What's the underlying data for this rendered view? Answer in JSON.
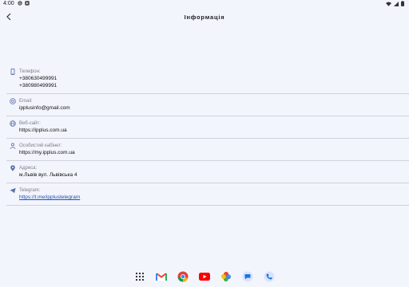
{
  "status_bar": {
    "time": "4:00",
    "icons": [
      "google-icon",
      "play-icon",
      "wifi-icon",
      "signal-icon",
      "battery-icon"
    ]
  },
  "app_bar": {
    "title": "Інформація",
    "back_icon": "arrow-back-icon"
  },
  "contacts": {
    "phone": {
      "label": "Телефон:",
      "values": [
        "+380630499991",
        "+380980499991"
      ],
      "icon": "phone-icon"
    },
    "email": {
      "label": "Email:",
      "value": "ipplusinfo@gmail.com",
      "icon": "at-icon"
    },
    "website": {
      "label": "Веб-сайт:",
      "value": "https://ipplus.com.ua",
      "icon": "globe-icon"
    },
    "cabinet": {
      "label": "Особистий кабінет:",
      "value": "https://my.ipplus.com.ua",
      "icon": "person-icon"
    },
    "address": {
      "label": "Адреса:",
      "value": "м.Львів вул. Львівська 4",
      "icon": "location-icon"
    },
    "telegram": {
      "label": "Telegram:",
      "value": "https://t.me/ipplustelegram",
      "icon": "telegram-icon"
    }
  },
  "dock": {
    "apps": [
      "app-drawer-icon",
      "gmail-icon",
      "chrome-icon",
      "youtube-icon",
      "photos-icon",
      "messages-icon",
      "phone-app-icon"
    ]
  },
  "colors": {
    "background": "#f3f5fc",
    "divider": "#cfd2dc",
    "label": "#7b7f8c",
    "link": "#1f4fb8",
    "icon": "#5b6fa8"
  }
}
